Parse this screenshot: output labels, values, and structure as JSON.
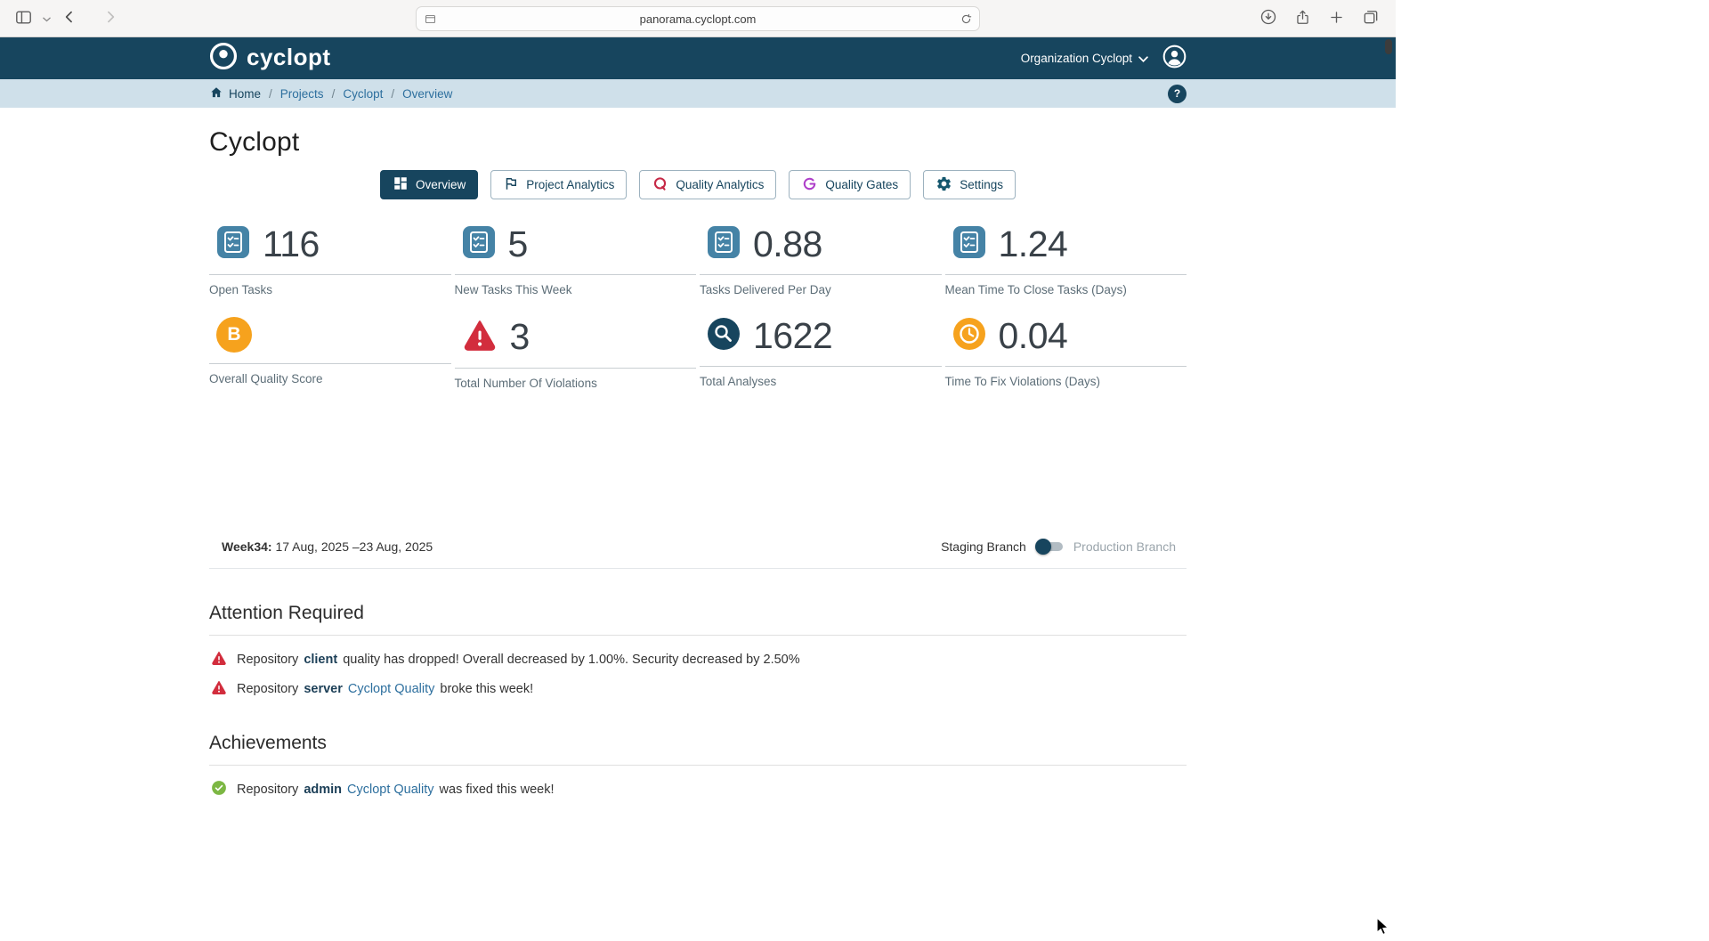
{
  "browser": {
    "url": "panorama.cyclopt.com"
  },
  "app_header": {
    "logo_text": "cyclopt",
    "org_button": "Organization Cyclopt"
  },
  "breadcrumbs": {
    "separator": "/",
    "home": "Home",
    "items": [
      {
        "label": "Projects"
      },
      {
        "label": "Cyclopt"
      },
      {
        "label": "Overview"
      }
    ],
    "help": "?"
  },
  "page": {
    "title": "Cyclopt"
  },
  "tabs": [
    {
      "label": "Overview",
      "active": true
    },
    {
      "label": "Project Analytics",
      "active": false
    },
    {
      "label": "Quality Analytics",
      "active": false
    },
    {
      "label": "Quality Gates",
      "active": false
    },
    {
      "label": "Settings",
      "active": false
    }
  ],
  "metrics": [
    {
      "value": "116",
      "label": "Open Tasks"
    },
    {
      "value": "5",
      "label": "New Tasks This Week"
    },
    {
      "value": "0.88",
      "label": "Tasks Delivered Per Day"
    },
    {
      "value": "1.24",
      "label": "Mean Time To Close Tasks (Days)"
    },
    {
      "badge": "B",
      "label": "Overall Quality Score"
    },
    {
      "value": "3",
      "label": "Total Number Of Violations"
    },
    {
      "value": "1622",
      "label": "Total Analyses"
    },
    {
      "value": "0.04",
      "label": "Time To Fix Violations (Days)"
    }
  ],
  "week_bar": {
    "week_label": "Week34:",
    "date_range": "17 Aug, 2025 –23 Aug, 2025",
    "staging": "Staging Branch",
    "production": "Production Branch"
  },
  "attention": {
    "title": "Attention Required",
    "items": [
      {
        "prefix": "Repository",
        "repo": "client",
        "text": "quality has dropped! Overall decreased by 1.00%. Security decreased by 2.50%"
      },
      {
        "prefix": "Repository",
        "repo": "server",
        "link": "Cyclopt Quality",
        "text": "broke this week!"
      }
    ]
  },
  "achievements": {
    "title": "Achievements",
    "items": [
      {
        "prefix": "Repository",
        "repo": "admin",
        "link": "Cyclopt Quality",
        "text": "was fixed this week!"
      }
    ]
  },
  "colors": {
    "header_navy": "#17455e",
    "breadcrumb_bg": "#cfe0ea",
    "link_blue": "#2d6f9e",
    "metric_icon_steel": "#4583a6",
    "orange": "#f6a21d",
    "alert_red": "#d22d3d",
    "success_green": "#7cb743",
    "quality_analytics_ring": "#c62846",
    "quality_gates_ring": "#ae3ec9"
  }
}
